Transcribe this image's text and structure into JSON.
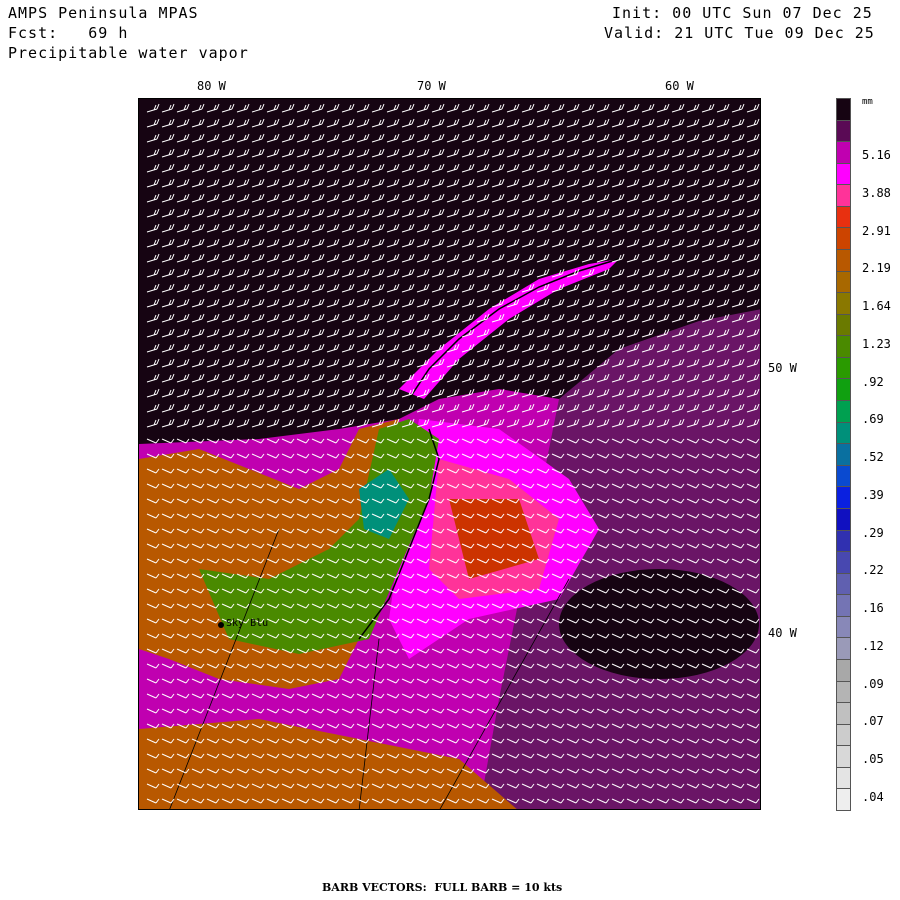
{
  "header": {
    "model": "AMPS Peninsula MPAS",
    "forecast": "Fcst:   69 h",
    "field": "Precipitable water vapor",
    "init": "Init: 00 UTC Sun 07 Dec 25",
    "valid": "Valid: 21 UTC Tue 09 Dec 25"
  },
  "map": {
    "top_labels": [
      "80 W",
      "70 W",
      "60 W"
    ],
    "right_labels": [
      "50 W",
      "40 W"
    ],
    "station": "Sky Blu"
  },
  "colorbar": {
    "units": "mm",
    "labels": [
      "5.16",
      "3.88",
      "2.91",
      "2.19",
      "1.64",
      "1.23",
      ".92",
      ".69",
      ".52",
      ".39",
      ".29",
      ".22",
      ".16",
      ".12",
      ".09",
      ".07",
      ".05",
      ".04"
    ],
    "colors": [
      "#160412",
      "#5a0a55",
      "#c000b0",
      "#ff00ff",
      "#ff3399",
      "#e83010",
      "#cc4400",
      "#b85800",
      "#a86800",
      "#8a7800",
      "#6a7a00",
      "#4a8a00",
      "#2a9a00",
      "#10a010",
      "#00a050",
      "#00907a",
      "#0a70a0",
      "#0a4ad0",
      "#0a20e0",
      "#1010c0",
      "#3030b0",
      "#4848b0",
      "#6060b0",
      "#7474b4",
      "#8888b8",
      "#9a9ab8",
      "#a8a8a8",
      "#b4b4b4",
      "#c0c0c0",
      "#cccccc",
      "#d8d8d8",
      "#e4e4e4",
      "#eeeeee"
    ]
  },
  "footer": "BARB VECTORS:  FULL BARB = 10 kts"
}
